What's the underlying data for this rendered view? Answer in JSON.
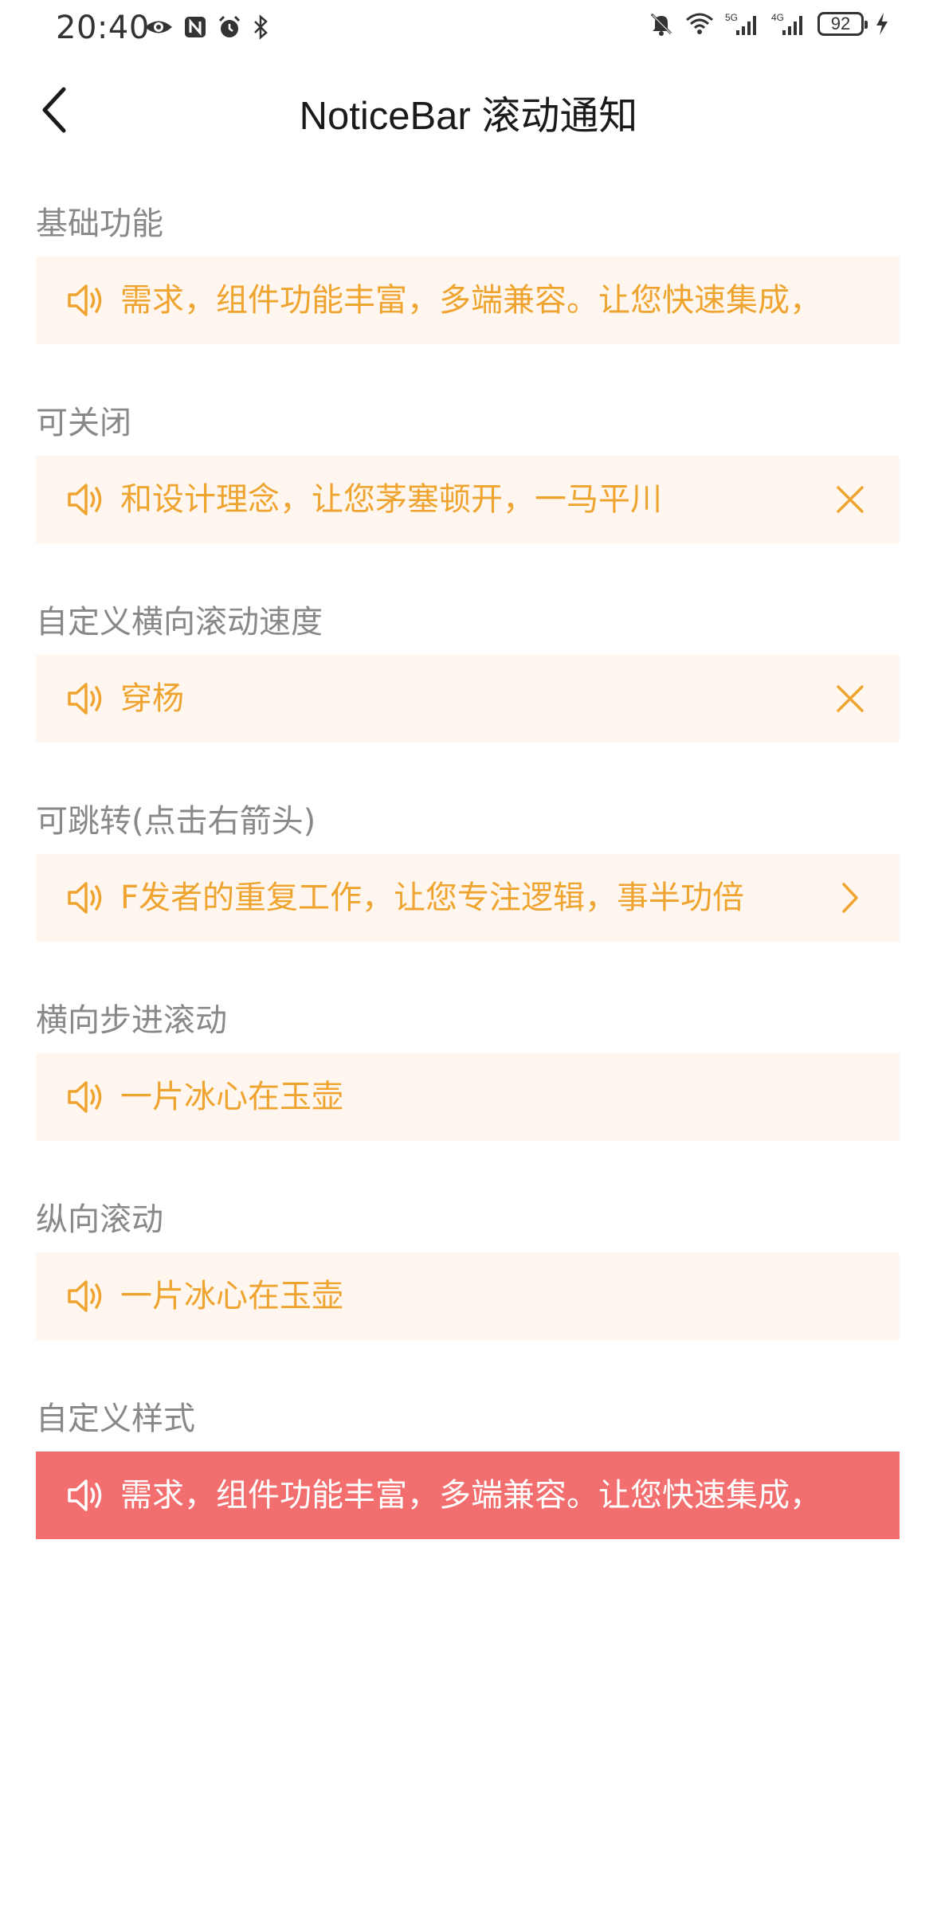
{
  "status_bar": {
    "time": "20:40",
    "battery": "92",
    "left_icons": [
      "eye-icon",
      "nfc-icon",
      "alarm-icon",
      "bluetooth-icon"
    ],
    "right_icons": [
      "bell-off-icon",
      "wifi-icon",
      "signal-5g-icon",
      "signal-4g-icon",
      "battery-icon",
      "charging-icon"
    ],
    "signal_labels": [
      "5G",
      "4G"
    ]
  },
  "nav": {
    "title": "NoticeBar 滚动通知"
  },
  "colors": {
    "notice_bg": "#fff7ef",
    "notice_text": "#f0a430",
    "custom_bg": "#f36e6e",
    "custom_text": "#ffffff",
    "section_title": "#888888"
  },
  "sections": [
    {
      "title": "基础功能",
      "text": "需求，组件功能丰富，多端兼容。让您快速集成，",
      "right_icon": "none"
    },
    {
      "title": "可关闭",
      "text": "和设计理念，让您茅塞顿开，一马平川",
      "right_icon": "close-icon"
    },
    {
      "title": "自定义横向滚动速度",
      "text": "穿杨",
      "right_icon": "close-icon"
    },
    {
      "title": "可跳转(点击右箭头)",
      "text": "F发者的重复工作，让您专注逻辑，事半功倍",
      "right_icon": "chevron-right-icon"
    },
    {
      "title": "横向步进滚动",
      "text": "一片冰心在玉壶",
      "right_icon": "none"
    },
    {
      "title": "纵向滚动",
      "text": "一片冰心在玉壶",
      "right_icon": "none"
    },
    {
      "title": "自定义样式",
      "text": "需求，组件功能丰富，多端兼容。让您快速集成，",
      "right_icon": "none"
    }
  ]
}
